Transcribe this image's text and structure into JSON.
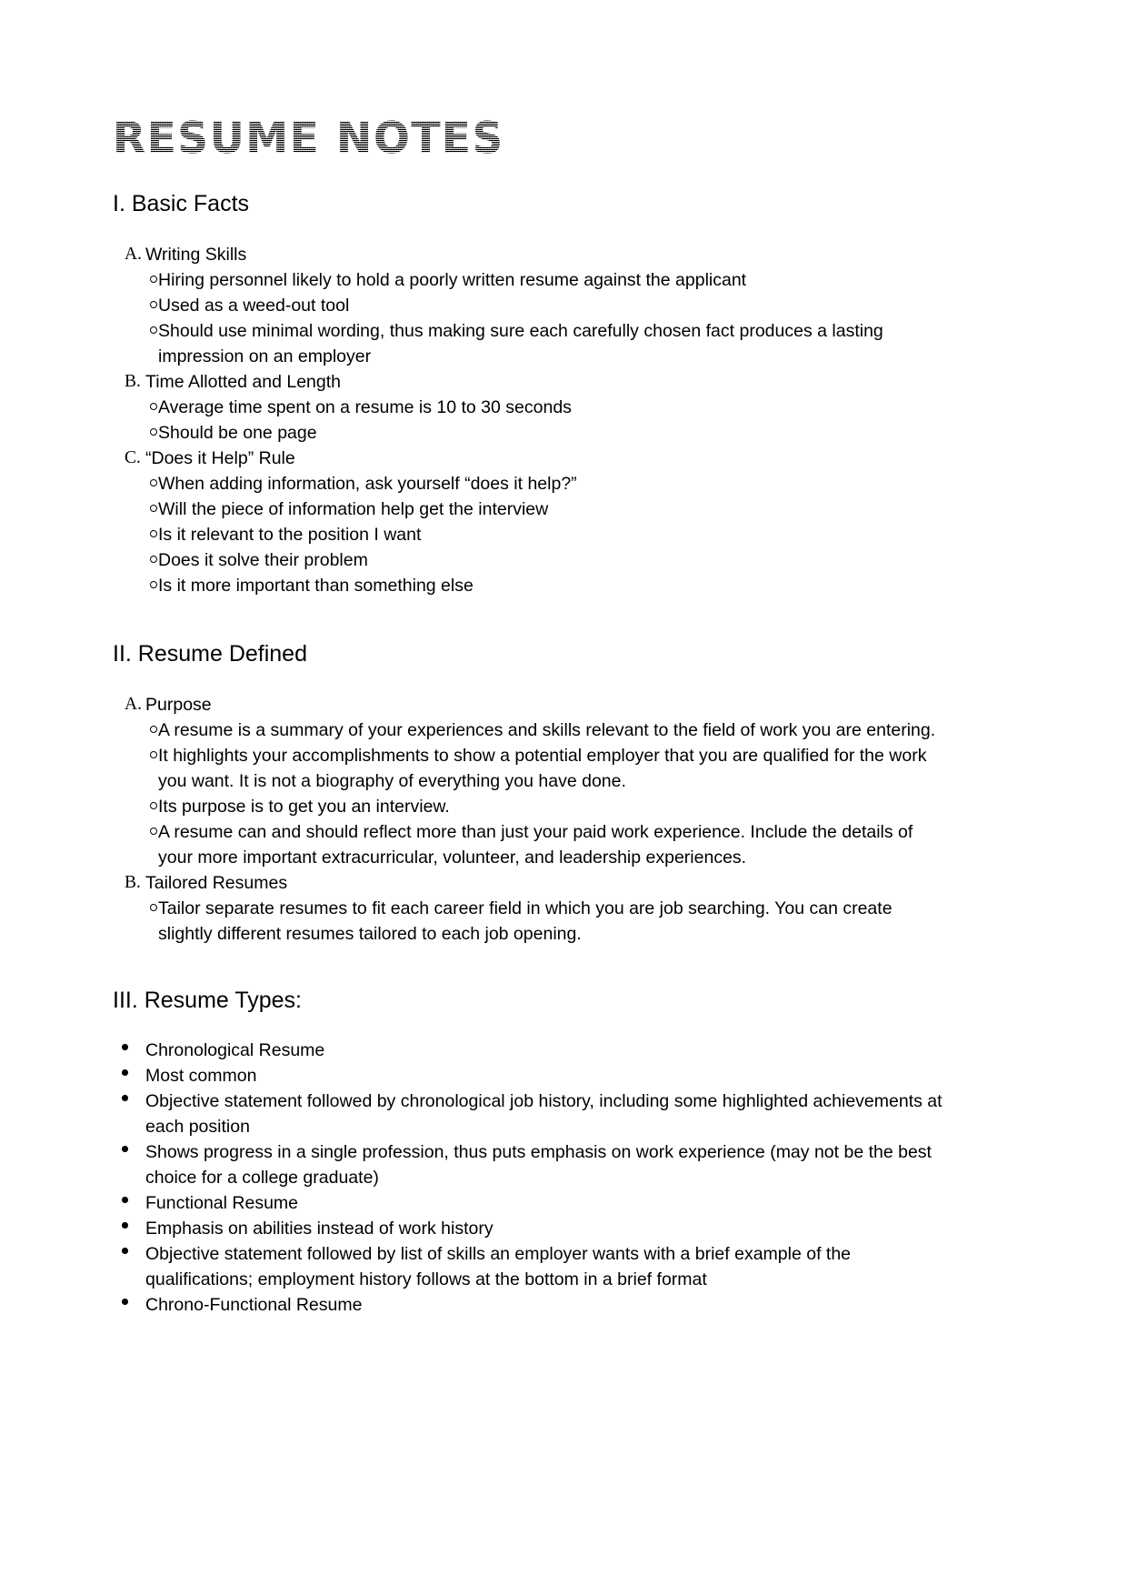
{
  "document": {
    "title": "RESUME NOTES",
    "sections": [
      {
        "heading": "I. Basic Facts",
        "list_style": "lettered",
        "items": [
          {
            "letter": "A.",
            "label": "Writing Skills",
            "subitems": [
              "Hiring personnel likely to hold a poorly written resume against the applicant",
              "Used as a weed-out tool",
              "Should use minimal wording, thus making sure each carefully chosen fact produces a lasting impression on an employer"
            ]
          },
          {
            "letter": "B.",
            "label": "Time Allotted and Length",
            "subitems": [
              "Average time spent on a resume is 10 to 30 seconds",
              "Should be one page"
            ]
          },
          {
            "letter": "C.",
            "label": "“Does it Help” Rule",
            "subitems": [
              "When adding information, ask yourself “does it help?”",
              "Will the piece of information help get the interview",
              "Is it relevant to the position I want",
              "Does it solve their problem",
              "Is it more important than something else"
            ]
          }
        ]
      },
      {
        "heading": "II. Resume Defined",
        "list_style": "lettered",
        "items": [
          {
            "letter": "A.",
            "label": "Purpose",
            "subitems": [
              "A resume is a summary of your experiences and skills relevant to the field of work you are entering.",
              "It highlights your accomplishments to show a potential employer that you are qualified for the work you want. It is not a biography of everything you have done.",
              "Its purpose is to get you an interview.",
              "A resume can and should reflect more than just your paid work experience.  Include the details of your more important extracurricular, volunteer, and leadership experiences."
            ]
          },
          {
            "letter": "B.",
            "label": "Tailored Resumes",
            "subitems": [
              "Tailor separate resumes to fit each career field in which you are job searching.  You can create slightly different resumes tailored to each job opening."
            ]
          }
        ]
      },
      {
        "heading": "III. Resume Types:",
        "list_style": "bulleted",
        "bullets": [
          "Chronological Resume",
          "Most common",
          "Objective statement followed by chronological job history, including some highlighted achievements at each position",
          "Shows progress in a single profession, thus puts emphasis on work experience (may not be the best choice for a college graduate)",
          "Functional Resume",
          "Emphasis on abilities instead of work history",
          "Objective statement followed by list of skills an employer wants with a brief example of the qualifications; employment history follows at the bottom in a brief format",
          "Chrono-Functional Resume"
        ]
      }
    ]
  }
}
